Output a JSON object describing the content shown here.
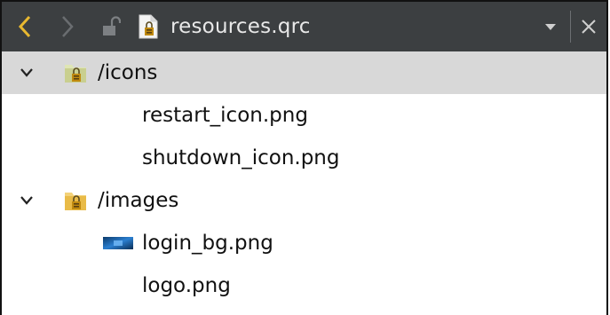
{
  "toolbar": {
    "back_icon": "chevron-left-icon",
    "forward_icon": "chevron-right-icon",
    "lock_icon": "unlock-icon",
    "file_icon": "qrc-file-icon",
    "file_name": "resources.qrc",
    "dropdown_icon": "dropdown-arrow-icon",
    "close_icon": "close-icon",
    "colors": {
      "background": "#3c3f41",
      "back_arrow": "#e8b830"
    }
  },
  "tree": {
    "items": [
      {
        "type": "folder",
        "label": "/icons",
        "expanded": true,
        "selected": true,
        "children": [
          {
            "type": "file",
            "label": "restart_icon.png"
          },
          {
            "type": "file",
            "label": "shutdown_icon.png"
          }
        ]
      },
      {
        "type": "folder",
        "label": "/images",
        "expanded": true,
        "selected": false,
        "children": [
          {
            "type": "file",
            "label": "login_bg.png",
            "icon": "image-thumbnail-icon"
          },
          {
            "type": "file",
            "label": "logo.png"
          }
        ]
      }
    ],
    "colors": {
      "selected_row": "#d8d8d8"
    }
  }
}
